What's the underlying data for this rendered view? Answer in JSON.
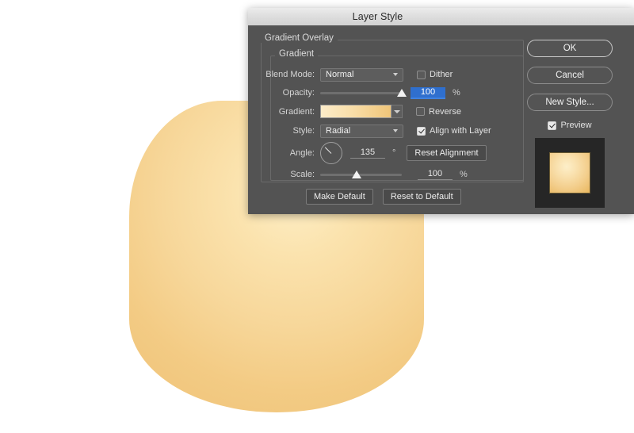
{
  "canvas": {
    "artwork_name": "gradient-blob-shape",
    "fill_light": "#fdeec6",
    "fill_mid": "#f7d79a",
    "fill_dark": "#efc277",
    "background": "#ffffff"
  },
  "dialog": {
    "title": "Layer Style",
    "groups": {
      "outer_title": "Gradient Overlay",
      "inner_title": "Gradient"
    },
    "fields": {
      "blend_mode_label": "Blend Mode:",
      "blend_mode_value": "Normal",
      "dither_label": "Dither",
      "dither_checked": false,
      "opacity_label": "Opacity:",
      "opacity_value": "100",
      "opacity_unit": "%",
      "gradient_label": "Gradient:",
      "reverse_label": "Reverse",
      "reverse_checked": false,
      "style_label": "Style:",
      "style_value": "Radial",
      "align_with_layer_label": "Align with Layer",
      "align_with_layer_checked": true,
      "angle_label": "Angle:",
      "angle_value": "135",
      "angle_unit": "°",
      "reset_alignment_label": "Reset Alignment",
      "scale_label": "Scale:",
      "scale_value": "100",
      "scale_unit": "%"
    },
    "footer": {
      "make_default_label": "Make Default",
      "reset_to_default_label": "Reset to Default"
    },
    "side": {
      "ok_label": "OK",
      "cancel_label": "Cancel",
      "new_style_label": "New Style...",
      "preview_label": "Preview",
      "preview_checked": true
    },
    "colors": {
      "titlebar": "#dcdcdc",
      "body": "#535353",
      "accent_selection": "#2f6fce",
      "gradient_start": "#fcecc9",
      "gradient_end": "#f0c579"
    }
  }
}
